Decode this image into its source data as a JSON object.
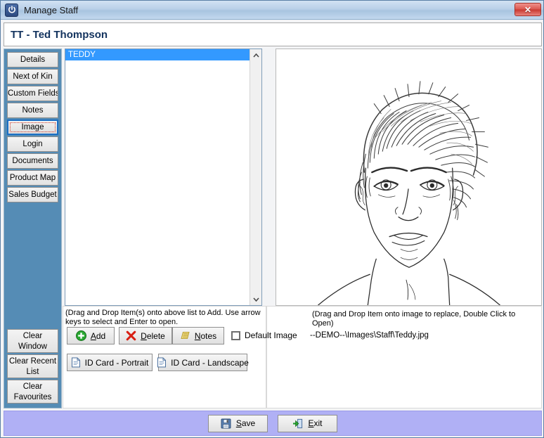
{
  "window": {
    "title": "Manage Staff",
    "app_icon": "power-icon",
    "close_label": "✕",
    "titlebar_color": "#b9d0e8",
    "sidebar_color": "#558cb5",
    "footer_color": "#b0b0f5"
  },
  "header": {
    "page_title": "TT - Ted Thompson",
    "title_color": "#13335e"
  },
  "sidebar": {
    "tabs": [
      {
        "label": "Details",
        "selected": false
      },
      {
        "label": "Next of Kin",
        "selected": false
      },
      {
        "label": "Custom Fields",
        "selected": false
      },
      {
        "label": "Notes",
        "selected": false
      },
      {
        "label": "Image",
        "selected": true
      },
      {
        "label": "Login",
        "selected": false
      },
      {
        "label": "Documents",
        "selected": false
      },
      {
        "label": "Product Map",
        "selected": false
      },
      {
        "label": "Sales Budget",
        "selected": false
      }
    ],
    "bottom_buttons": [
      {
        "label": "Clear Window Positions"
      },
      {
        "label": "Clear Recent List"
      },
      {
        "label": "Clear Favourites"
      }
    ]
  },
  "list_panel": {
    "items": [
      {
        "label": "TEDDY",
        "selected": true
      }
    ],
    "selected_color": "#3399ff",
    "hint": "(Drag and Drop Item(s) onto above list to Add. Use arrow keys to select and Enter to open.",
    "scroll_up_icon": "chevron-up-icon",
    "scroll_down_icon": "chevron-down-icon"
  },
  "actions": {
    "add": {
      "label_before": "",
      "mnemonic": "A",
      "label_after": "dd",
      "icon": "green-plus-icon"
    },
    "delete": {
      "label_before": "",
      "mnemonic": "D",
      "label_after": "elete",
      "icon": "red-x-icon"
    },
    "notes": {
      "label_before": "",
      "mnemonic": "N",
      "label_after": "otes",
      "icon": "notepad-icon"
    },
    "id_card_portrait": {
      "label": "ID Card - Portrait",
      "icon": "document-icon"
    },
    "id_card_landscape": {
      "label": "ID Card - Landscape",
      "icon": "document-icon"
    }
  },
  "default_image": {
    "label": "Default Image",
    "checked": false
  },
  "image_panel": {
    "hint": "(Drag and Drop Item onto image to replace, Double Click to Open)",
    "path": "--DEMO--\\Images\\Staff\\Teddy.jpg",
    "alt": "Pencil sketch portrait of a young man with spiky hair"
  },
  "footer": {
    "save": {
      "mnemonic": "S",
      "label_after": "ave",
      "icon": "floppy-save-icon"
    },
    "exit": {
      "mnemonic": "E",
      "label_after": "xit",
      "icon": "exit-door-icon"
    }
  }
}
